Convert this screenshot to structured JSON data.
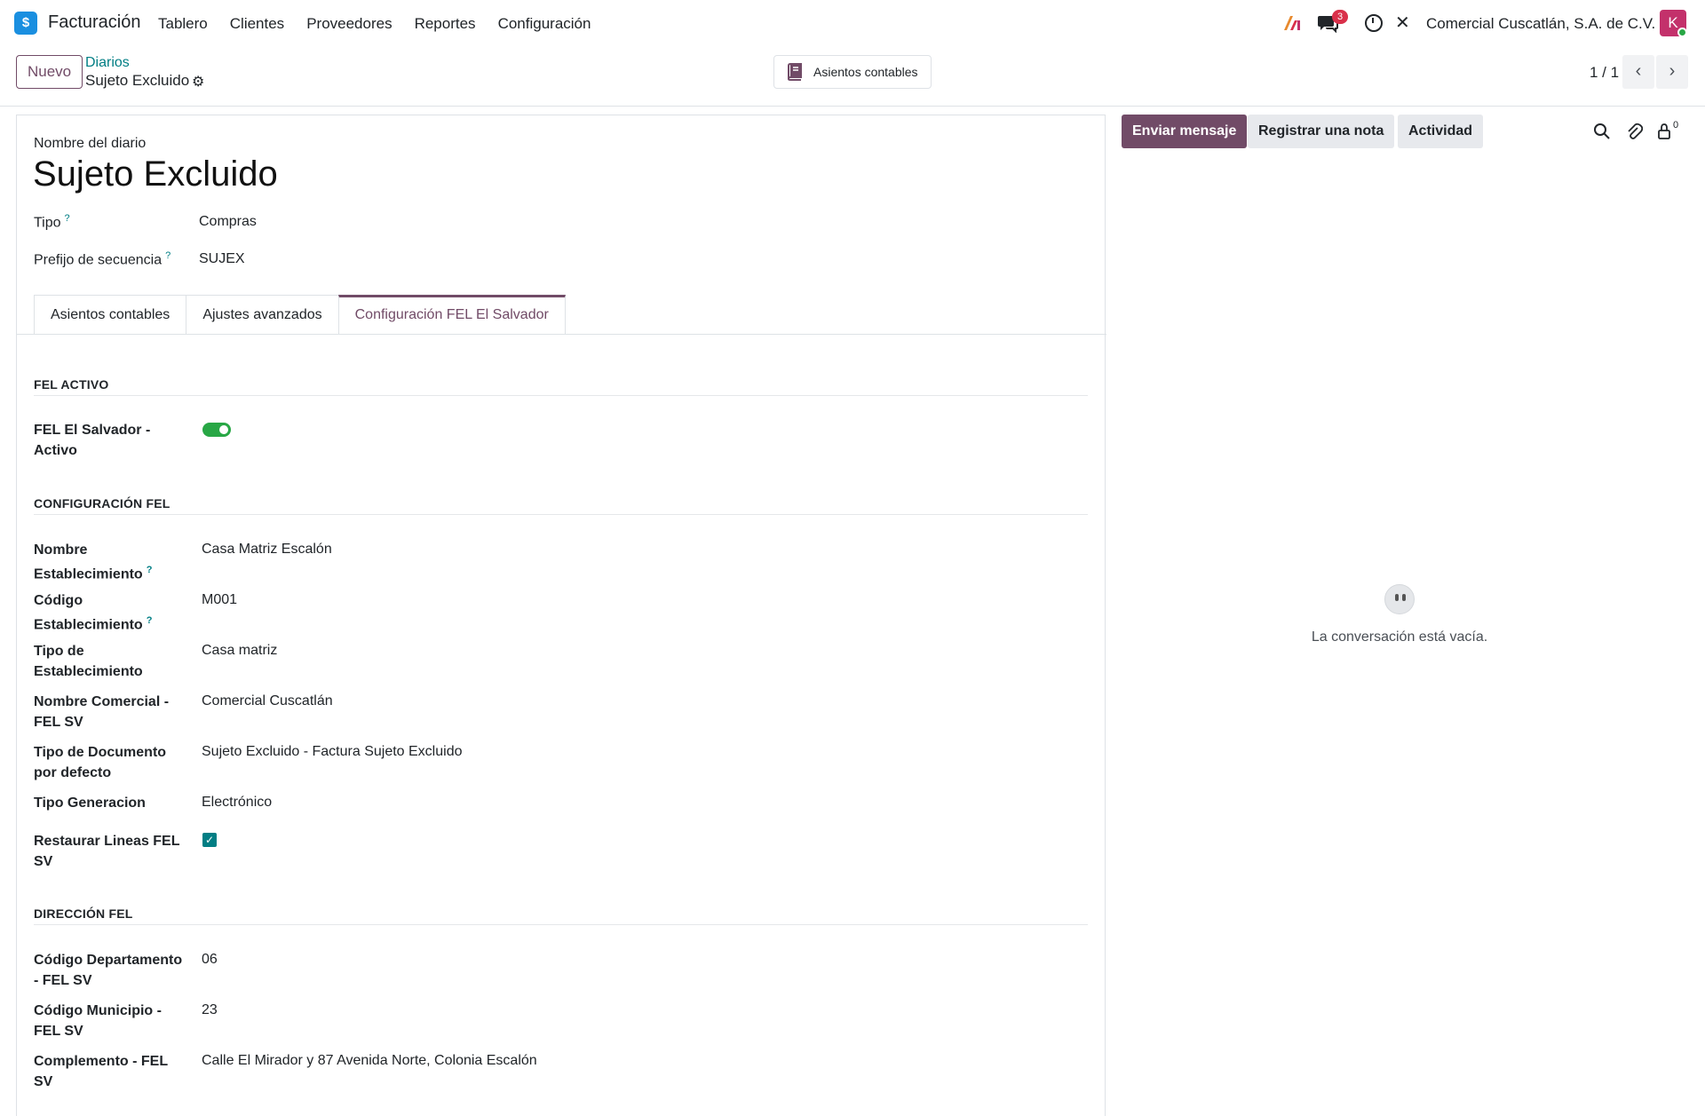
{
  "app": {
    "name": "Facturación",
    "logo_glyph": "$",
    "menu": [
      "Tablero",
      "Clientes",
      "Proveedores",
      "Reportes",
      "Configuración"
    ],
    "chat_badge": "3",
    "company": "Comercial Cuscatlán, S.A. de C.V.",
    "avatar_initial": "K"
  },
  "control": {
    "new_label": "Nuevo",
    "breadcrumb_parent": "Diarios",
    "breadcrumb_current": "Sujeto Excluido",
    "smart_button": "Asientos contables",
    "pager": "1 / 1"
  },
  "form": {
    "name_label": "Nombre del diario",
    "name_value": "Sujeto Excluido",
    "type_label": "Tipo",
    "type_value": "Compras",
    "prefix_label": "Prefijo de secuencia",
    "prefix_value": "SUJEX",
    "tabs": [
      "Asientos contables",
      "Ajustes avanzados",
      "Configuración FEL El Salvador"
    ],
    "active_tab": 2,
    "sections": {
      "fel_active": "FEL ACTIVO",
      "fel_config": "CONFIGURACIÓN FEL",
      "fel_address": "DIRECCIÓN FEL"
    },
    "fel_active": {
      "label": "FEL El Salvador - Activo",
      "value": true
    },
    "fields": [
      {
        "label": "Nombre Establecimiento",
        "value": "Casa Matriz Escalón",
        "help": true
      },
      {
        "label": "Código Establecimiento",
        "value": "M001",
        "help": true
      },
      {
        "label": "Tipo de Establecimiento",
        "value": "Casa matriz"
      },
      {
        "label": "Nombre Comercial - FEL SV",
        "value": "Comercial Cuscatlán"
      },
      {
        "label": "Tipo de Documento por defecto",
        "value": "Sujeto Excluido - Factura Sujeto Excluido"
      },
      {
        "label": "Tipo Generacion",
        "value": "Electrónico"
      }
    ],
    "restore_lines": {
      "label": "Restaurar Lineas FEL SV",
      "value": true
    },
    "address_fields": [
      {
        "label": "Código Departamento - FEL SV",
        "value": "06"
      },
      {
        "label": "Código Municipio - FEL SV",
        "value": "23"
      },
      {
        "label": "Complemento - FEL SV",
        "value": "Calle El Mirador y 87 Avenida Norte, Colonia Escalón"
      }
    ]
  },
  "chatter": {
    "send_message": "Enviar mensaje",
    "log_note": "Registrar una nota",
    "activity": "Actividad",
    "follower_count": "0",
    "empty_message": "La conversación está vacía."
  },
  "colors": {
    "brand": "#714b67",
    "link": "#017e84",
    "toggle_on": "#28a745",
    "badge": "#d9304a",
    "avatar": "#c3316b"
  }
}
